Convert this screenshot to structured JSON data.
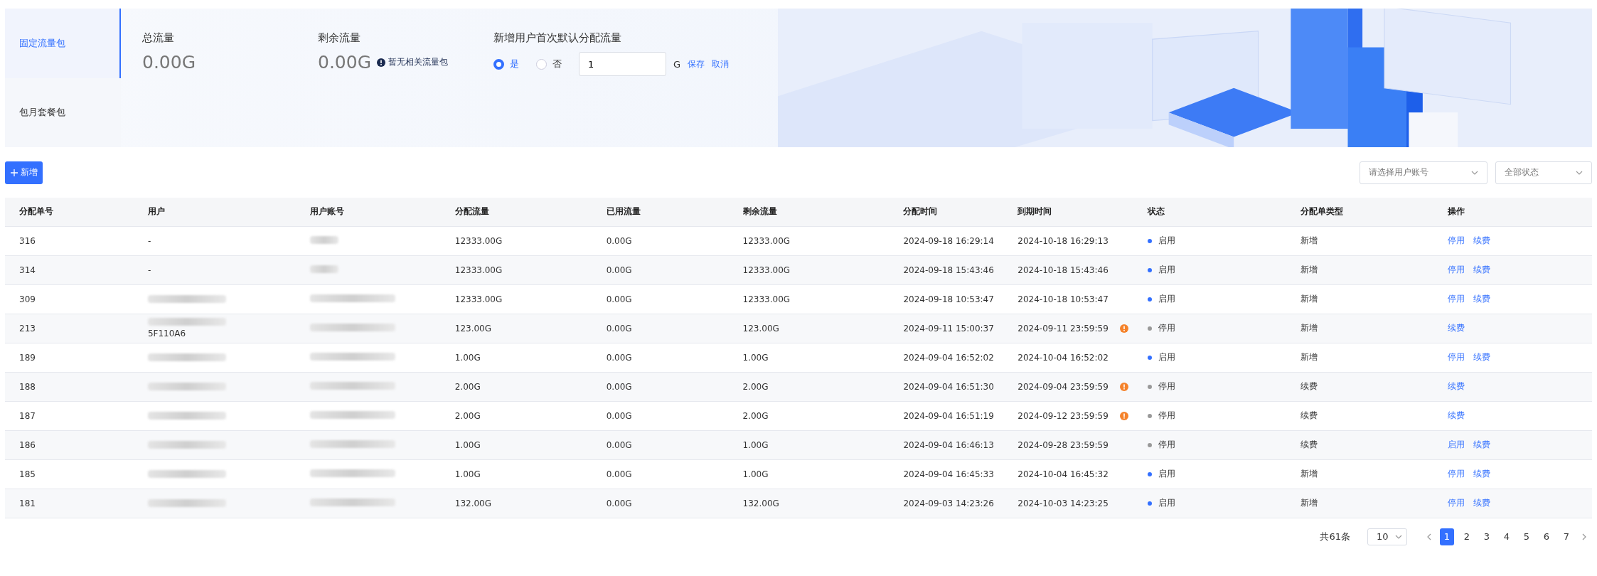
{
  "package_tabs": [
    {
      "label": "固定流量包",
      "selected": true
    },
    {
      "label": "包月套餐包",
      "selected": false
    }
  ],
  "stats": [
    {
      "label": "总流量",
      "value": "0.00G"
    },
    {
      "label": "剩余流量",
      "value": "0.00G",
      "notice": "暂无相关流量包"
    }
  ],
  "default_allocation": {
    "label": "新增用户首次默认分配流量",
    "options": [
      {
        "label": "是",
        "selected": true
      },
      {
        "label": "否",
        "selected": false
      }
    ],
    "value": "1",
    "unit": "G",
    "save": "保存",
    "cancel": "取消"
  },
  "add_button": "新增",
  "filters": [
    {
      "placeholder": "请选择用户账号"
    },
    {
      "placeholder": "全部状态"
    }
  ],
  "table": {
    "columns": [
      "分配单号",
      "用户",
      "用户账号",
      "分配流量",
      "已用流量",
      "剩余流量",
      "分配时间",
      "到期时间",
      "状态",
      "分配单类型",
      "操作"
    ],
    "rows": [
      {
        "id": "316",
        "user": "-",
        "user_redacted": false,
        "account_redacted": true,
        "allocated": "12333.00G",
        "used": "0.00G",
        "remaining": "12333.00G",
        "assigned_at": "2024-09-18 16:29:14",
        "expires_at": "2024-10-18 16:29:13",
        "expired": false,
        "status": "启用",
        "enabled": true,
        "type": "新增",
        "actions": [
          "停用",
          "续费"
        ]
      },
      {
        "id": "314",
        "user": "-",
        "user_redacted": false,
        "account_redacted": true,
        "allocated": "12333.00G",
        "used": "0.00G",
        "remaining": "12333.00G",
        "assigned_at": "2024-09-18 15:43:46",
        "expires_at": "2024-10-18 15:43:46",
        "expired": false,
        "status": "启用",
        "enabled": true,
        "type": "新增",
        "actions": [
          "停用",
          "续费"
        ]
      },
      {
        "id": "309",
        "user_redacted": true,
        "account_redacted": true,
        "allocated": "12333.00G",
        "used": "0.00G",
        "remaining": "12333.00G",
        "assigned_at": "2024-09-18 10:53:47",
        "expires_at": "2024-10-18 10:53:47",
        "expired": false,
        "status": "启用",
        "enabled": true,
        "type": "新增",
        "actions": [
          "停用",
          "续费"
        ]
      },
      {
        "id": "213",
        "user_redacted": true,
        "user_tail": "5F110A6",
        "account_redacted": true,
        "allocated": "123.00G",
        "used": "0.00G",
        "remaining": "123.00G",
        "assigned_at": "2024-09-11 15:00:37",
        "expires_at": "2024-09-11 23:59:59",
        "expired": true,
        "status": "停用",
        "enabled": false,
        "type": "新增",
        "actions": [
          "续费"
        ]
      },
      {
        "id": "189",
        "user_redacted": true,
        "account_redacted": true,
        "allocated": "1.00G",
        "used": "0.00G",
        "remaining": "1.00G",
        "assigned_at": "2024-09-04 16:52:02",
        "expires_at": "2024-10-04 16:52:02",
        "expired": false,
        "status": "启用",
        "enabled": true,
        "type": "新增",
        "actions": [
          "停用",
          "续费"
        ]
      },
      {
        "id": "188",
        "user_redacted": true,
        "account_redacted": true,
        "allocated": "2.00G",
        "used": "0.00G",
        "remaining": "2.00G",
        "assigned_at": "2024-09-04 16:51:30",
        "expires_at": "2024-09-04 23:59:59",
        "expired": true,
        "status": "停用",
        "enabled": false,
        "type": "续费",
        "actions": [
          "续费"
        ]
      },
      {
        "id": "187",
        "user_redacted": true,
        "account_redacted": true,
        "allocated": "2.00G",
        "used": "0.00G",
        "remaining": "2.00G",
        "assigned_at": "2024-09-04 16:51:19",
        "expires_at": "2024-09-12 23:59:59",
        "expired": true,
        "status": "停用",
        "enabled": false,
        "type": "续费",
        "actions": [
          "续费"
        ]
      },
      {
        "id": "186",
        "user_redacted": true,
        "account_redacted": true,
        "allocated": "1.00G",
        "used": "0.00G",
        "remaining": "1.00G",
        "assigned_at": "2024-09-04 16:46:13",
        "expires_at": "2024-09-28 23:59:59",
        "expired": false,
        "status": "停用",
        "enabled": false,
        "type": "续费",
        "actions": [
          "启用",
          "续费"
        ]
      },
      {
        "id": "185",
        "user_redacted": true,
        "account_redacted": true,
        "allocated": "1.00G",
        "used": "0.00G",
        "remaining": "1.00G",
        "assigned_at": "2024-09-04 16:45:33",
        "expires_at": "2024-10-04 16:45:32",
        "expired": false,
        "status": "启用",
        "enabled": true,
        "type": "新增",
        "actions": [
          "停用",
          "续费"
        ]
      },
      {
        "id": "181",
        "user_redacted": true,
        "account_redacted": true,
        "allocated": "132.00G",
        "used": "0.00G",
        "remaining": "132.00G",
        "assigned_at": "2024-09-03 14:23:26",
        "expires_at": "2024-10-03 14:23:25",
        "expired": false,
        "status": "启用",
        "enabled": true,
        "type": "新增",
        "actions": [
          "停用",
          "续费"
        ]
      }
    ]
  },
  "pagination": {
    "total": "共61条",
    "page_size": "10",
    "pages": [
      {
        "label": "1",
        "selected": true
      },
      {
        "label": "2",
        "selected": false
      },
      {
        "label": "3",
        "selected": false
      },
      {
        "label": "4",
        "selected": false
      },
      {
        "label": "5",
        "selected": false
      },
      {
        "label": "6",
        "selected": false
      },
      {
        "label": "7",
        "selected": false
      }
    ]
  }
}
